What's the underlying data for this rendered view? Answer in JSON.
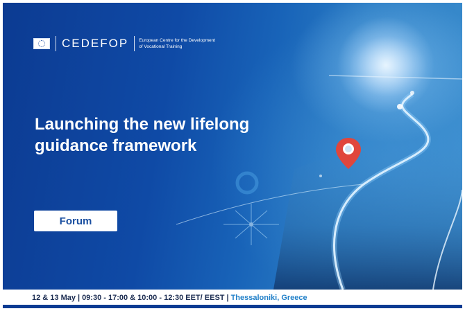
{
  "logo": {
    "emblem": "eu-flag-icon",
    "wordmark": "CEDEFOP",
    "tagline_line1": "European Centre for the Development",
    "tagline_line2": "of Vocational Training"
  },
  "headline": {
    "line1": "Launching the new lifelong",
    "line2": "guidance framework"
  },
  "badge": {
    "label": "Forum"
  },
  "info_bar": {
    "dates": "12 & 13 May",
    "times": "09:30 - 17:00 & 10:00 - 12:30 EET/ EEST",
    "location": "Thessaloniki, Greece",
    "separator": "|"
  },
  "colors": {
    "brand_blue": "#0c3b92",
    "accent_blue": "#1f7fc8",
    "text_dark": "#1c2d52",
    "white": "#ffffff",
    "pin_red": "#e0463c"
  }
}
